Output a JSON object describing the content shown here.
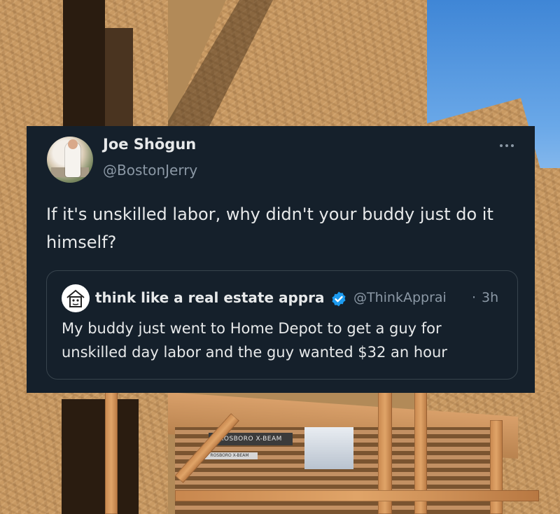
{
  "tweet": {
    "author": {
      "display_name": "Joe Shōgun",
      "handle": "@BostonJerry",
      "avatar_icon": "profile-photo"
    },
    "more_icon": "more-horizontal-icon",
    "text": "If it's unskilled labor, why didn't your buddy just do it himself?",
    "quoted": {
      "display_name": "think like a real estate appra",
      "verified_icon": "verified-badge-icon",
      "handle": "@ThinkApprai",
      "separator": "·",
      "time": "3h",
      "text": "My buddy just went to Home Depot to get a guy for unskilled day labor and the guy wanted $32 an hour"
    }
  },
  "background": {
    "lumber_wrap_label": "ROSBORO X-BEAM",
    "lumber_wrap_label_small": "ROSBORO X-BEAM"
  },
  "colors": {
    "card_background": "#15202b",
    "primary_text": "#e7e9ea",
    "secondary_text": "#8b98a5",
    "border": "#38444d",
    "verified_blue": "#1d9bf0"
  }
}
